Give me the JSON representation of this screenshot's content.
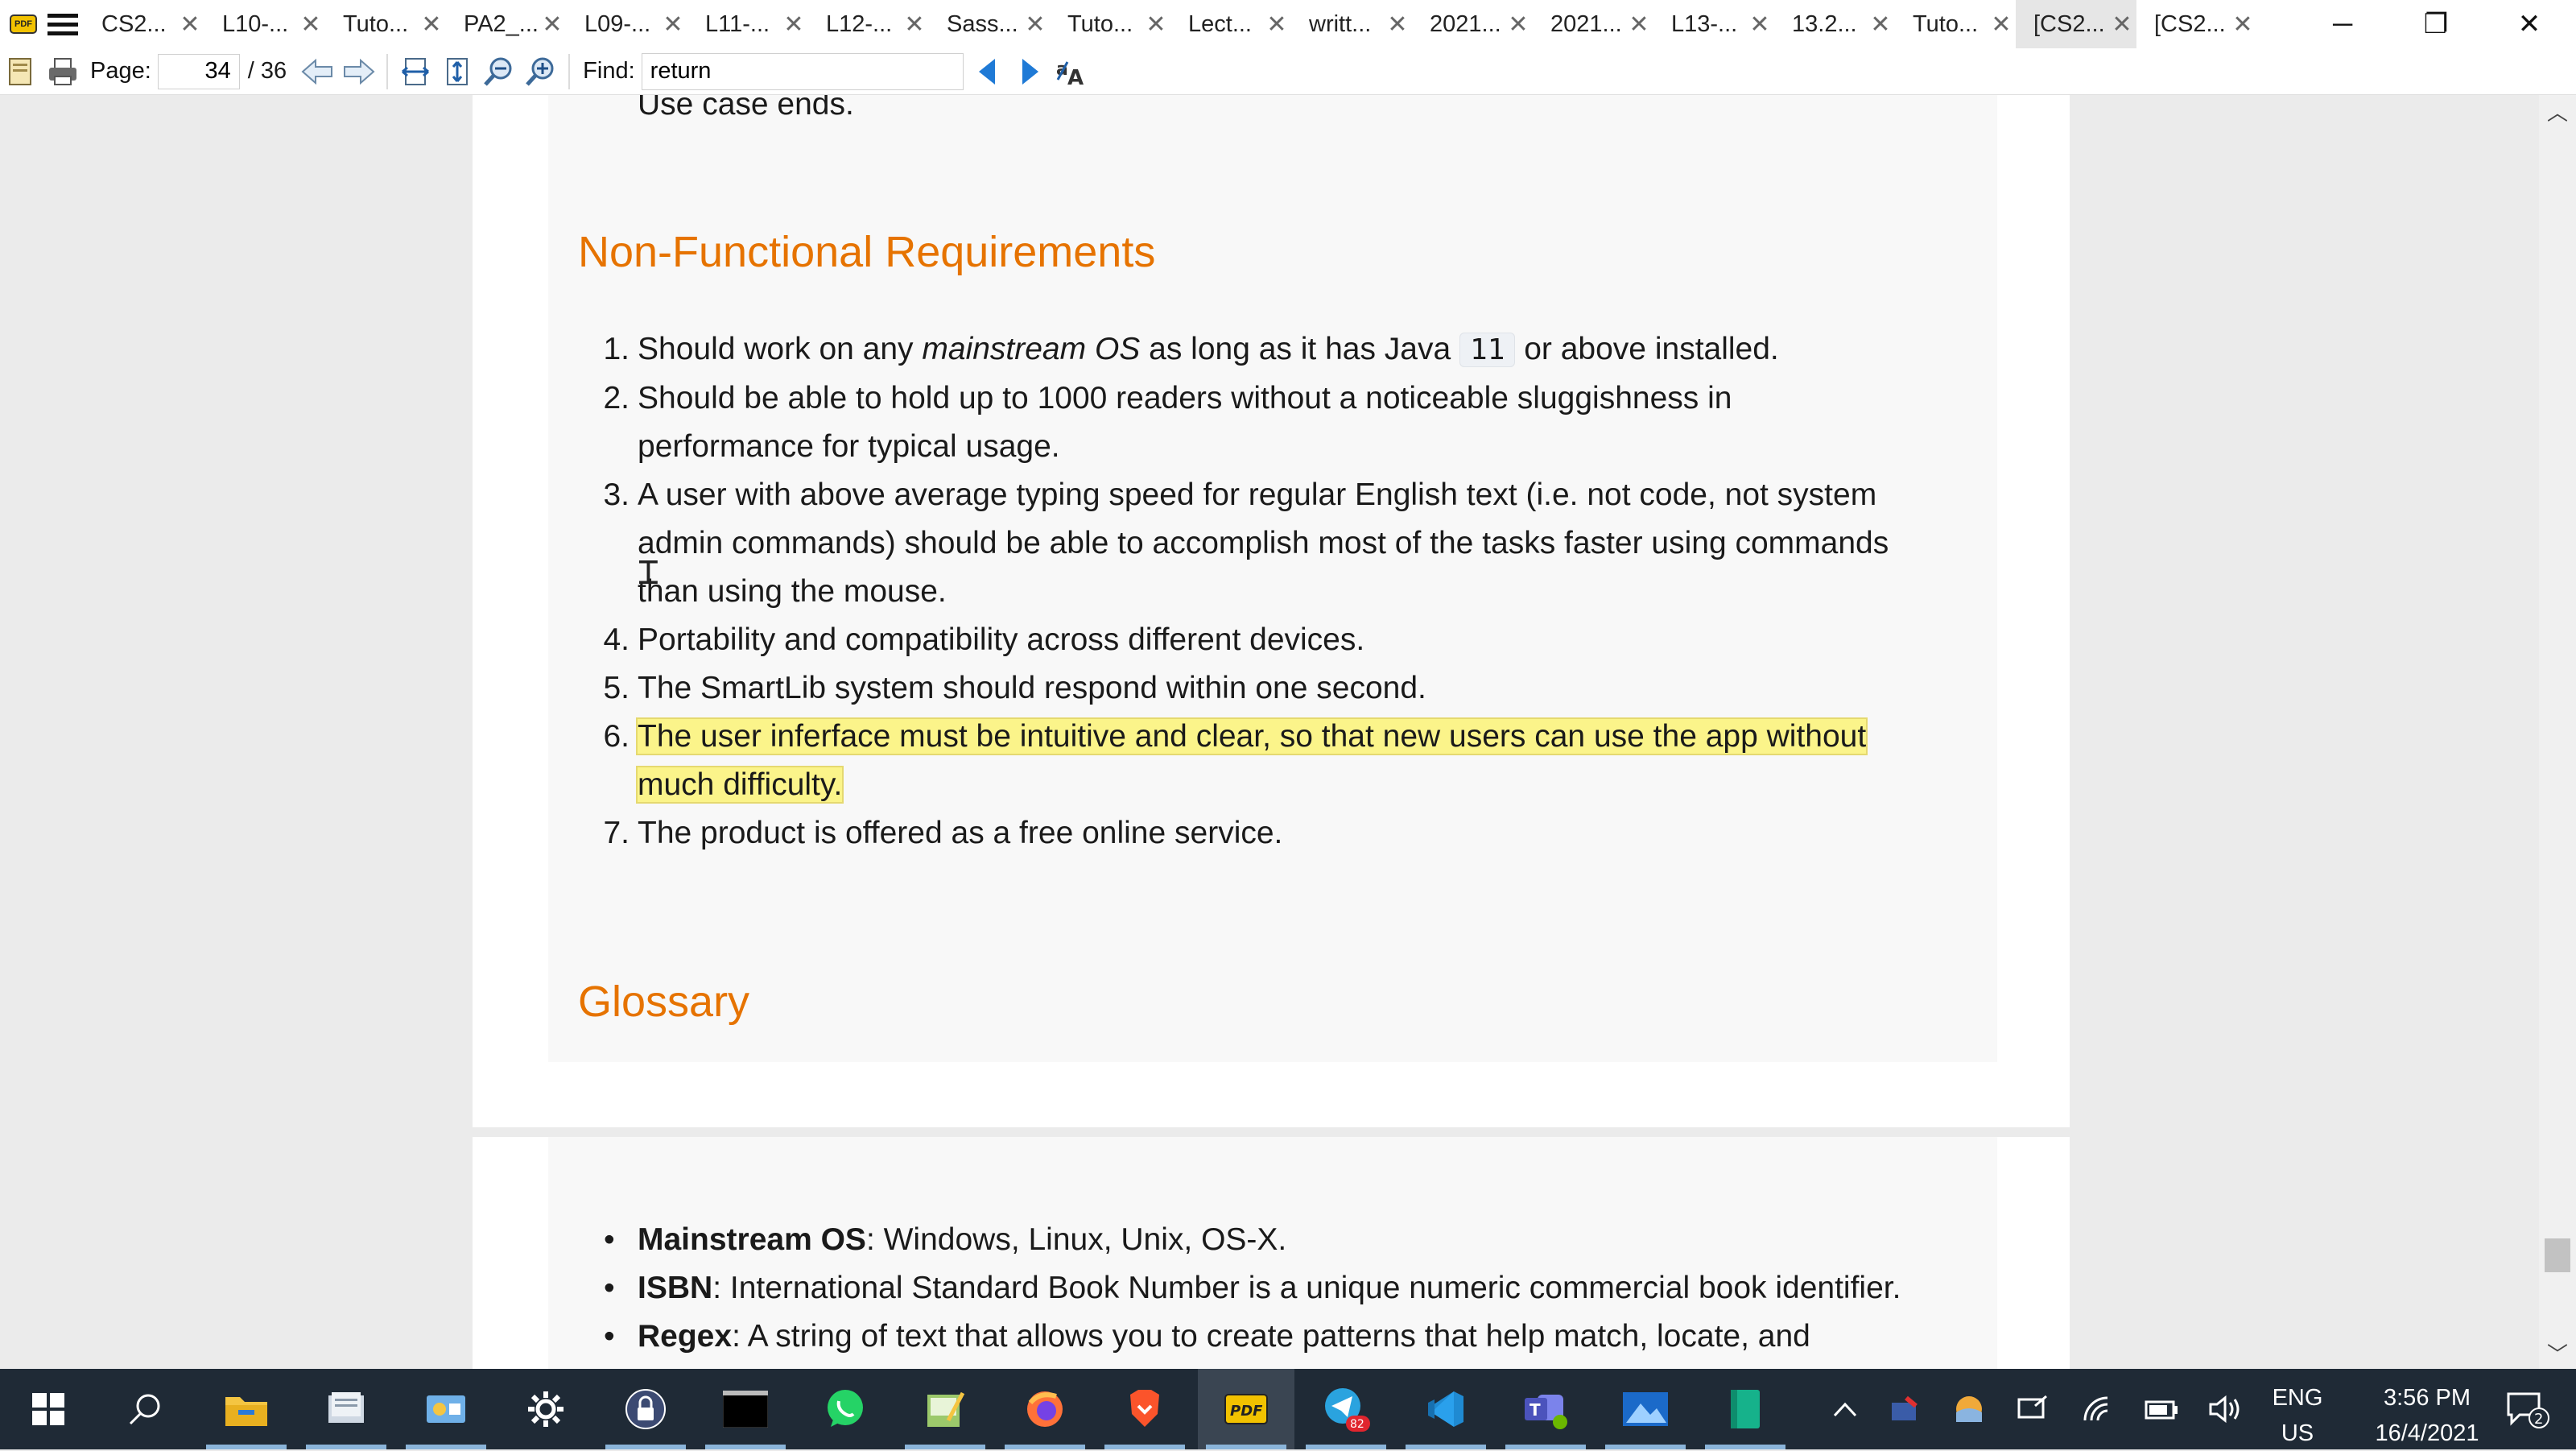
{
  "tabbar": {
    "logo_text": "PDF",
    "tabs": [
      {
        "label": "CS2..."
      },
      {
        "label": "L10-..."
      },
      {
        "label": "Tuto..."
      },
      {
        "label": "PA2_..."
      },
      {
        "label": "L09-..."
      },
      {
        "label": "L11-..."
      },
      {
        "label": "L12-..."
      },
      {
        "label": "Sass..."
      },
      {
        "label": "Tuto..."
      },
      {
        "label": "Lect..."
      },
      {
        "label": "writt..."
      },
      {
        "label": "2021..."
      },
      {
        "label": "2021..."
      },
      {
        "label": "L13-..."
      },
      {
        "label": "13.2..."
      },
      {
        "label": "Tuto..."
      },
      {
        "label": "[CS2..."
      },
      {
        "label": "[CS2..."
      }
    ],
    "active_tab_index": 16,
    "close_glyph": "✕",
    "window_controls": {
      "minimize": "─",
      "restore": "❐",
      "close": "✕"
    }
  },
  "toolbar": {
    "page_label": "Page:",
    "page_value": "34",
    "page_total": "/ 36",
    "find_label": "Find:",
    "find_value": "return"
  },
  "document": {
    "prev_line": "Use case ends.",
    "nfr_heading": "Non-Functional Requirements",
    "nfr_items": [
      {
        "num": "1.",
        "before": "Should work on any ",
        "em": "mainstream OS",
        "middle": " as long as it has Java ",
        "code": "11",
        "after": " or above installed."
      },
      {
        "num": "2.",
        "line1": "Should be able to hold up to 1000 readers without a noticeable sluggishness in",
        "line2": "performance for typical usage."
      },
      {
        "num": "3.",
        "line1": "A user with above average typing speed for regular English text (i.e. not code, not system",
        "line2": "admin commands) should be able to accomplish most of the tasks faster using commands",
        "line3": "than using the mouse."
      },
      {
        "num": "4.",
        "line1": "Portability and compatibility across different devices."
      },
      {
        "num": "5.",
        "line1": "The SmartLib system should respond within one second."
      },
      {
        "num": "6.",
        "line1": "The user inferface must be intuitive and clear, so that new users can use the app without",
        "line2": "much difficulty."
      },
      {
        "num": "7.",
        "line1": "The product is offered as a free online service."
      }
    ],
    "glossary_heading": "Glossary",
    "glossary": [
      {
        "term": "Mainstream OS",
        "def": ": Windows, Linux, Unix, OS-X."
      },
      {
        "term": "ISBN",
        "def": ": International Standard Book Number is a unique numeric commercial book identifier."
      },
      {
        "term": "Regex",
        "def": ": A string of text that allows you to create patterns that help match, locate, and"
      }
    ],
    "colors": {
      "heading": "#e67300",
      "highlight": "#fbf48a"
    }
  },
  "taskbar": {
    "apps": [
      {
        "name": "file-explorer"
      },
      {
        "name": "documents"
      },
      {
        "name": "control-panel"
      },
      {
        "name": "settings"
      },
      {
        "name": "keepass"
      },
      {
        "name": "terminal"
      },
      {
        "name": "whatsapp"
      },
      {
        "name": "notepad"
      },
      {
        "name": "firefox"
      },
      {
        "name": "brave"
      },
      {
        "name": "pdf-reader"
      },
      {
        "name": "telegram",
        "badge": "82"
      },
      {
        "name": "vscode"
      },
      {
        "name": "teams"
      },
      {
        "name": "photos"
      },
      {
        "name": "notes"
      }
    ],
    "lang_top": "ENG",
    "lang_bottom": "US",
    "time": "3:56 PM",
    "date": "16/4/2021",
    "notification_count": "2"
  }
}
